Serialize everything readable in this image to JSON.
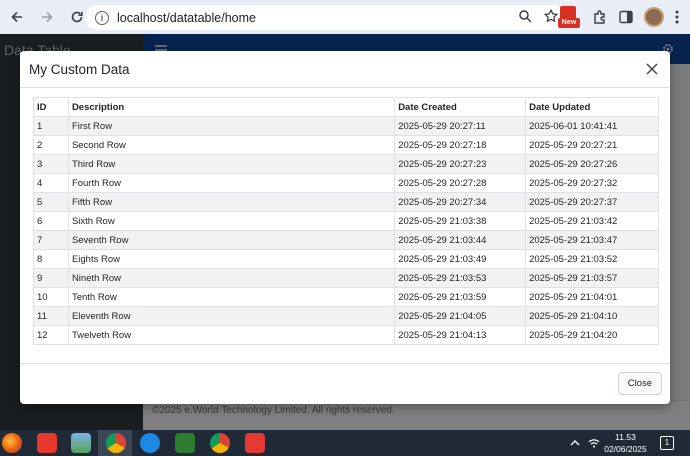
{
  "browser": {
    "url": "localhost/datatable/home",
    "extension_badge": "New"
  },
  "app": {
    "brand": "Data Table",
    "footer_text": "©2025 e.World Technology Limited. All rights reserved."
  },
  "modal": {
    "title": "My Custom Data",
    "close_label": "Close",
    "columns": [
      "ID",
      "Description",
      "Date Created",
      "Date Updated"
    ],
    "rows": [
      [
        "1",
        "First Row",
        "2025-05-29 20:27:11",
        "2025-06-01 10:41:41"
      ],
      [
        "2",
        "Second Row",
        "2025-05-29 20:27:18",
        "2025-05-29 20:27:21"
      ],
      [
        "3",
        "Third Row",
        "2025-05-29 20:27:23",
        "2025-05-29 20:27:26"
      ],
      [
        "4",
        "Fourth Row",
        "2025-05-29 20:27:28",
        "2025-05-29 20:27:32"
      ],
      [
        "5",
        "Fifth Row",
        "2025-05-29 20:27:34",
        "2025-05-29 20:27:37"
      ],
      [
        "6",
        "Sixth Row",
        "2025-05-29 21:03:38",
        "2025-05-29 21:03:42"
      ],
      [
        "7",
        "Seventh Row",
        "2025-05-29 21:03:44",
        "2025-05-29 21:03:47"
      ],
      [
        "8",
        "Eights Row",
        "2025-05-29 21:03:49",
        "2025-05-29 21:03:52"
      ],
      [
        "9",
        "Nineth Row",
        "2025-05-29 21:03:53",
        "2025-05-29 21:03:57"
      ],
      [
        "10",
        "Tenth Row",
        "2025-05-29 21:03:59",
        "2025-05-29 21:04:01"
      ],
      [
        "11",
        "Eleventh Row",
        "2025-05-29 21:04:05",
        "2025-05-29 21:04:10"
      ],
      [
        "12",
        "Twelveth Row",
        "2025-05-29 21:04:13",
        "2025-05-29 21:04:20"
      ]
    ]
  },
  "taskbar": {
    "time": "11.53",
    "date": "02/06/2025",
    "notification_count": "1"
  },
  "colors": {
    "sidebar": "#343a40",
    "navbar": "#0d47a1",
    "taskbar": "#1f2a36",
    "stripe": "#f2f2f2"
  }
}
